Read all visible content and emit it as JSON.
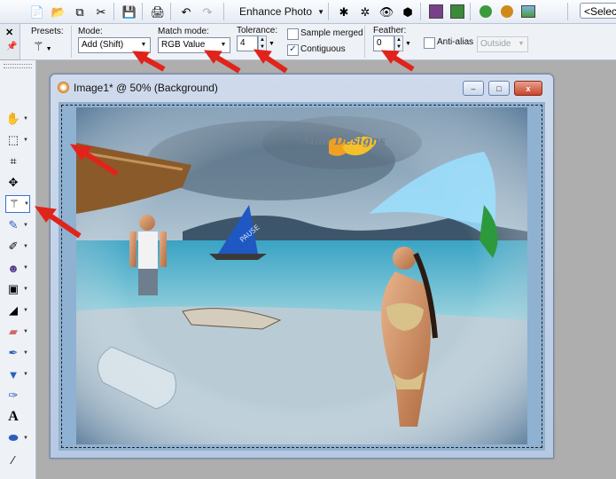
{
  "toolbar": {
    "enhance_label": "Enhance Photo",
    "select_label": "<Selec",
    "icons": [
      "new-icon",
      "open-icon",
      "copy-icon",
      "scissors-icon",
      "save-icon",
      "print-icon",
      "undo-icon",
      "redo-icon",
      "color-balance-icon",
      "clarify-icon",
      "red-eye-icon",
      "brush-icon",
      "portrait-icon",
      "frame-icon",
      "effect-icon",
      "effect2-icon",
      "landscape-icon"
    ]
  },
  "options": {
    "presets_label": "Presets:",
    "mode_label": "Mode:",
    "mode_value": "Add (Shift)",
    "match_mode_label": "Match mode:",
    "match_mode_value": "RGB Value",
    "tolerance_label": "Tolerance:",
    "tolerance_value": "4",
    "sample_merged_label": "Sample merged",
    "sample_merged_checked": false,
    "contiguous_label": "Contiguous",
    "contiguous_checked": true,
    "feather_label": "Feather:",
    "feather_value": "0",
    "anti_alias_label": "Anti-alias",
    "anti_alias_checked": false,
    "outside_value": "Outside"
  },
  "tools": [
    "pan-icon",
    "selection-icon",
    "crop-icon",
    "move-icon",
    "magic-wand-icon",
    "paint-brush-icon",
    "clone-icon",
    "makeover-icon",
    "scratch-remover-icon",
    "dodge-icon",
    "eraser-icon",
    "picture-tube-icon",
    "fill-icon",
    "pen-icon",
    "text-icon",
    "shape-icon",
    "color-picker-icon"
  ],
  "window": {
    "title": "Image1* @  50% (Background)",
    "minimize_label": "–",
    "maximize_label": "□",
    "close_label": "x"
  },
  "artwork": {
    "watermark": "Mad Designs",
    "sail_text": "PAUSE"
  },
  "colors": {
    "accent": "#3a6fd0",
    "arrow_red": "#e0241b",
    "sea": "#4aa8c6",
    "sky": "#9bb6cc"
  }
}
